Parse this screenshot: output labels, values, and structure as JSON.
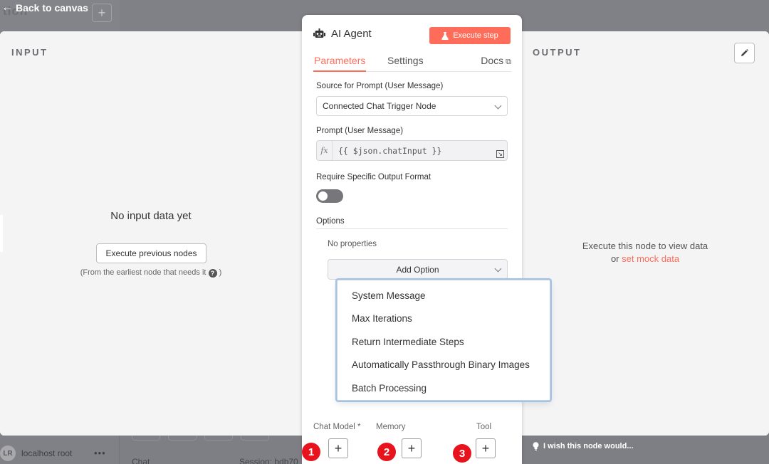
{
  "background": {
    "back_label": "Back to canvas",
    "ghost_title": "tion",
    "user_initials": "LR",
    "user_name": "localhost root",
    "more": "•••",
    "chat_label": "Chat",
    "session_label": "Session: bdb70"
  },
  "input_panel": {
    "title": "INPUT",
    "empty_title": "No input data yet",
    "execute_button": "Execute previous nodes",
    "hint": "(From the earliest node that needs it",
    "help": "?",
    "hint_end": ")"
  },
  "output_panel": {
    "title": "OUTPUT",
    "line1": "Execute this node to view data",
    "line2_prefix": "or",
    "mock_link": "set mock data"
  },
  "node": {
    "title": "AI Agent",
    "execute_step": "Execute step",
    "tabs": [
      {
        "label": "Parameters",
        "active": true
      },
      {
        "label": "Settings",
        "active": false
      },
      {
        "label": "Docs",
        "active": false
      }
    ],
    "source_label": "Source for Prompt (User Message)",
    "source_value": "Connected Chat Trigger Node",
    "prompt_label": "Prompt (User Message)",
    "prompt_fx": "fx",
    "prompt_value": "{{ $json.chatInput }}",
    "format_label": "Require Specific Output Format",
    "format_enabled": false,
    "options_label": "Options",
    "no_properties": "No properties",
    "add_option": "Add Option",
    "connectors": [
      {
        "label": "Chat Model *",
        "marker": "1"
      },
      {
        "label": "Memory",
        "marker": "2"
      },
      {
        "label": "Tool",
        "marker": "3"
      }
    ]
  },
  "dropdown": {
    "items": [
      "System Message",
      "Max Iterations",
      "Return Intermediate Steps",
      "Automatically Passthrough Binary Images",
      "Batch Processing"
    ]
  },
  "feedback": {
    "label": "I wish this node would..."
  },
  "colors": {
    "accent": "#ff6d5a",
    "marker": "#e8141d",
    "overlay": "#7d7d82"
  }
}
